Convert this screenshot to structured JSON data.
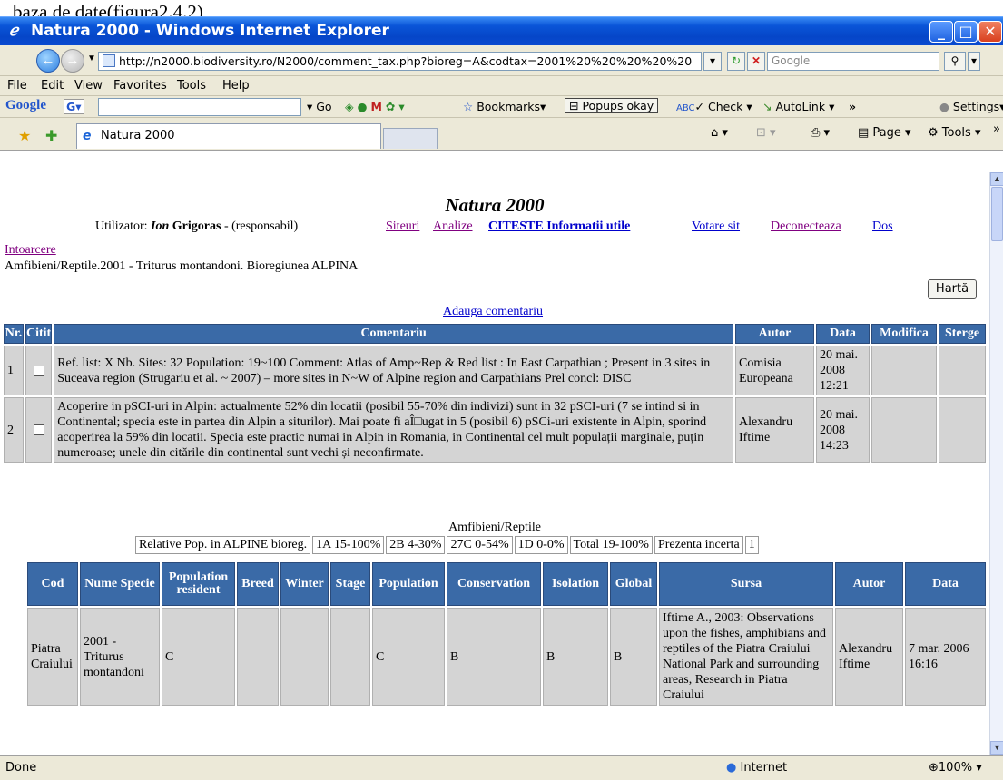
{
  "doc_text": "baza de date(figura2.4.2)",
  "window": {
    "title": "Natura 2000 - Windows Internet Explorer"
  },
  "address": {
    "url": "http://n2000.biodiversity.ro/N2000/comment_tax.php?bioreg=A&codtax=2001%20%20%20%20%20",
    "search_placeholder": "Google"
  },
  "menu": [
    "File",
    "Edit",
    "View",
    "Favorites",
    "Tools",
    "Help"
  ],
  "googlebar": {
    "logo": "Google",
    "go": "Go",
    "bookmarks": "Bookmarks▾",
    "popups": "Popups okay",
    "check": "Check ▾",
    "autolink": "AutoLink ▾",
    "more": "»",
    "settings": "Settings▾"
  },
  "tab": {
    "label": "Natura 2000"
  },
  "toolbar": {
    "page": "Page ▾",
    "tools": "Tools ▾"
  },
  "page": {
    "title": "Natura 2000",
    "user_label": "Utilizator:",
    "user_first": "Ion",
    "user_last": "Grigoras",
    "user_role": "- (responsabil)",
    "links": {
      "siteuri": "Siteuri",
      "analize": "Analize",
      "citeste": "CITESTE Informatii utile",
      "votare": "Votare sit",
      "deconecteaza": "Deconecteaza",
      "dos": "Dos"
    },
    "intoarcere": "Intoarcere",
    "species_line": "Amfibieni/Reptile.2001 - Triturus montandoni. Bioregiunea ALPINA",
    "harta": "Hartă",
    "adauga": "Adauga comentariu"
  },
  "comments": {
    "headers": [
      "Nr.",
      "Citit",
      "Comentariu",
      "Autor",
      "Data",
      "Modifica",
      "Sterge"
    ],
    "rows": [
      {
        "nr": "1",
        "text": "Ref. list: X Nb. Sites: 32 Population: 19~100 Comment: Atlas of Amp~Rep & Red list : In East Carpathian ; Present in 3 sites in Suceava region (Strugariu et al. ~ 2007) – more sites in N~W of Alpine region and Carpathians Prel concl: DISC",
        "author": "Comisia Europeana",
        "date": "20 mai. 2008 12:21"
      },
      {
        "nr": "2",
        "text": "Acoperire in pSCI-uri in Alpin: actualmente 52% din locatii (posibil 55-70% din indivizi) sunt in 32 pSCI-uri (7 se intind si in Continental; specia este in partea din Alpin a siturilor). Mai poate fi aÎ□ugat in 5 (posibil 6) pSCi-uri existente in Alpin, sporind acoperirea la 59% din locatii. Specia este practic numai in Alpin in Romania, in Continental cel mult populații marginale, puțin numeroase; unele din citările din continental sunt vechi și neconfirmate.",
        "author": "Alexandru Iftime",
        "date": "20 mai. 2008 14:23"
      }
    ]
  },
  "summary": {
    "group": "Amfibieni/Reptile",
    "cells": [
      "Relative Pop. in ALPINE bioreg.",
      "1A 15-100%",
      "2B 4-30%",
      "27C 0-54%",
      "1D 0-0%",
      "Total 19-100%",
      "Prezenta incerta",
      "1"
    ]
  },
  "sites": {
    "headers": [
      "Cod",
      "Nume Specie",
      "Population resident",
      "Breed",
      "Winter",
      "Stage",
      "Population",
      "Conservation",
      "Isolation",
      "Global",
      "Sursa",
      "Autor",
      "Data"
    ],
    "rows": [
      {
        "cod": "Piatra Craiului",
        "nume": "2001 - Triturus montandoni",
        "resident": "C",
        "breed": "",
        "winter": "",
        "stage": "",
        "population": "C",
        "conservation": "B",
        "isolation": "B",
        "global": "B",
        "sursa": "Iftime A., 2003: Observations upon the fishes, amphibians and reptiles of the Piatra Craiului National Park and surrounding areas, Research in Piatra Craiului",
        "autor": "Alexandru Iftime",
        "data": "7 mar. 2006 16:16"
      }
    ]
  },
  "status": {
    "done": "Done",
    "zone": "Internet",
    "zoom": "100%"
  }
}
